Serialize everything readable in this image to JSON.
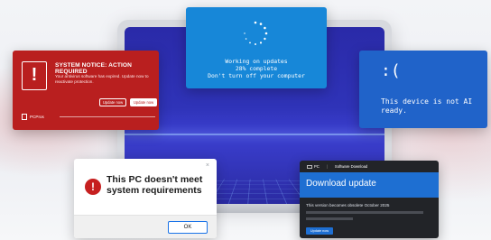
{
  "update_window": {
    "line1": "Working on updates",
    "line2": "28% complete",
    "line3": "Don't turn off your computer",
    "progress_percent": 28
  },
  "system_notice": {
    "icon": "exclamation-icon",
    "title": "SYSTEM NOTICE: ACTION REQUIRED",
    "body": "Your antivirus software has expired. Update now to reactivate protection.",
    "button_secondary": "Update now",
    "button_primary": "Update now",
    "brand": "PCPros",
    "color": "#b91f1f"
  },
  "bsod": {
    "face": ":(",
    "message": "This device is not AI ready.",
    "color": "#2063c9"
  },
  "requirement_dialog": {
    "icon": "error-icon",
    "message": "This PC doesn't meet system requirements",
    "ok_label": "OK",
    "close_glyph": "×"
  },
  "download_card": {
    "brand": "PC",
    "tab": "Software Download",
    "title": "Download update",
    "notice": "This version becomes obsolete October 2025",
    "button": "Update now",
    "accent": "#1e6fd2"
  }
}
